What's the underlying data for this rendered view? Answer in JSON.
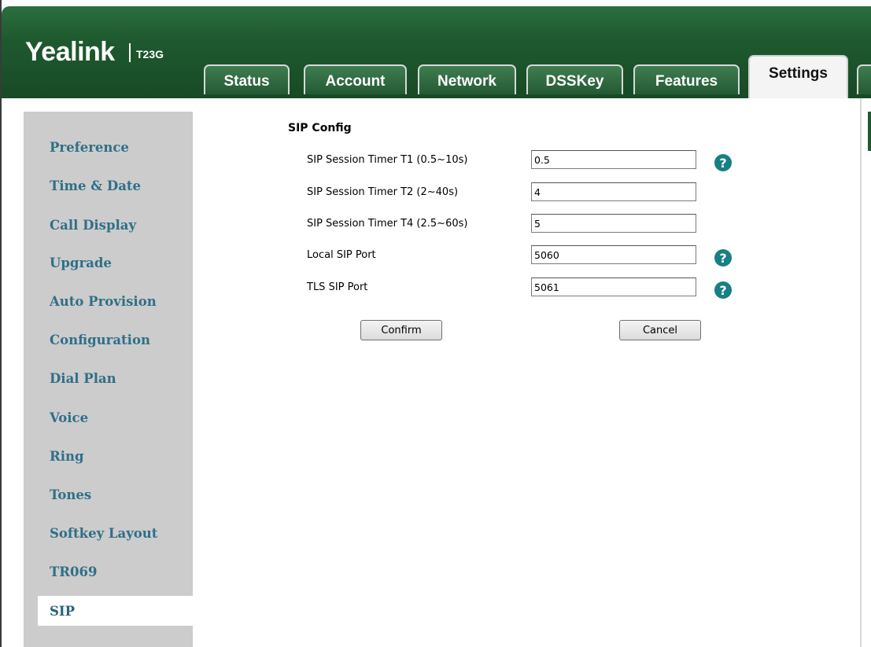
{
  "header": {
    "brand": "Yealink",
    "model": "T23G"
  },
  "tabs": [
    {
      "label": "Status",
      "active": false
    },
    {
      "label": "Account",
      "active": false
    },
    {
      "label": "Network",
      "active": false
    },
    {
      "label": "DSSKey",
      "active": false
    },
    {
      "label": "Features",
      "active": false
    },
    {
      "label": "Settings",
      "active": true
    }
  ],
  "sidebar": {
    "items": [
      {
        "label": "Preference"
      },
      {
        "label": "Time & Date"
      },
      {
        "label": "Call Display"
      },
      {
        "label": "Upgrade"
      },
      {
        "label": "Auto Provision"
      },
      {
        "label": "Configuration"
      },
      {
        "label": "Dial Plan"
      },
      {
        "label": "Voice"
      },
      {
        "label": "Ring"
      },
      {
        "label": "Tones"
      },
      {
        "label": "Softkey Layout"
      },
      {
        "label": "TR069"
      },
      {
        "label": "SIP"
      }
    ],
    "active": "SIP"
  },
  "main": {
    "section_title": "SIP Config",
    "fields": [
      {
        "label": "SIP Session Timer T1 (0.5~10s)",
        "value": "0.5",
        "help": true
      },
      {
        "label": "SIP Session Timer T2 (2~40s)",
        "value": "4",
        "help": false
      },
      {
        "label": "SIP Session Timer T4 (2.5~60s)",
        "value": "5",
        "help": false
      },
      {
        "label": "Local SIP Port",
        "value": "5060",
        "help": true
      },
      {
        "label": "TLS SIP Port",
        "value": "5061",
        "help": true
      }
    ],
    "help_glyph": "?",
    "confirm_label": "Confirm",
    "cancel_label": "Cancel"
  },
  "colors": {
    "header_green": "#1f5a2f",
    "sidebar_gray": "#cccccc",
    "sidebar_text": "#2f6f87",
    "help_teal": "#178082"
  },
  "icons": {
    "help": "question-circle-icon"
  }
}
